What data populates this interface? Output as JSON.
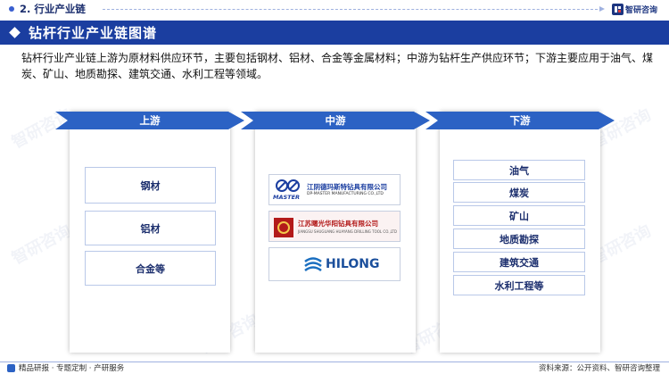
{
  "header": {
    "section": "2. 行业产业链",
    "logo_text": "智研咨询"
  },
  "banner": {
    "title": "钻杆行业产业链图谱"
  },
  "description": "钻杆行业产业链上游为原材料供应环节，主要包括钢材、铝材、合金等金属材料；中游为钻杆生产供应环节；下游主要应用于油气、煤炭、矿山、地质勘探、建筑交通、水利工程等领域。",
  "watermark": "智研咨询",
  "upstream": {
    "label": "上游",
    "items": [
      "钢材",
      "铝材",
      "合金等"
    ]
  },
  "midstream": {
    "label": "中游",
    "companies": [
      {
        "name_cn": "江阴德玛斯特钻具有限公司",
        "name_en": "DP-MASTER MANUFACTURING CO.,LTD",
        "mark": "MASTER"
      },
      {
        "name_cn": "江苏曙光华阳钻具有限公司",
        "name_en": "JIANGSU SHUGUANG HUAYANG DRILLING TOOL CO.,LTD"
      },
      {
        "mark": "HILONG"
      }
    ]
  },
  "downstream": {
    "label": "下游",
    "items": [
      "油气",
      "煤炭",
      "矿山",
      "地质勘探",
      "建筑交通",
      "水利工程等"
    ]
  },
  "footer": {
    "left": "精品研报 · 专题定制 · 产研服务",
    "right": "资料来源：公开资料、智研咨询整理"
  },
  "colors": {
    "banner": "#1b3ea0",
    "arrow": "#2c62c4",
    "text_dark": "#1c2f6e"
  }
}
